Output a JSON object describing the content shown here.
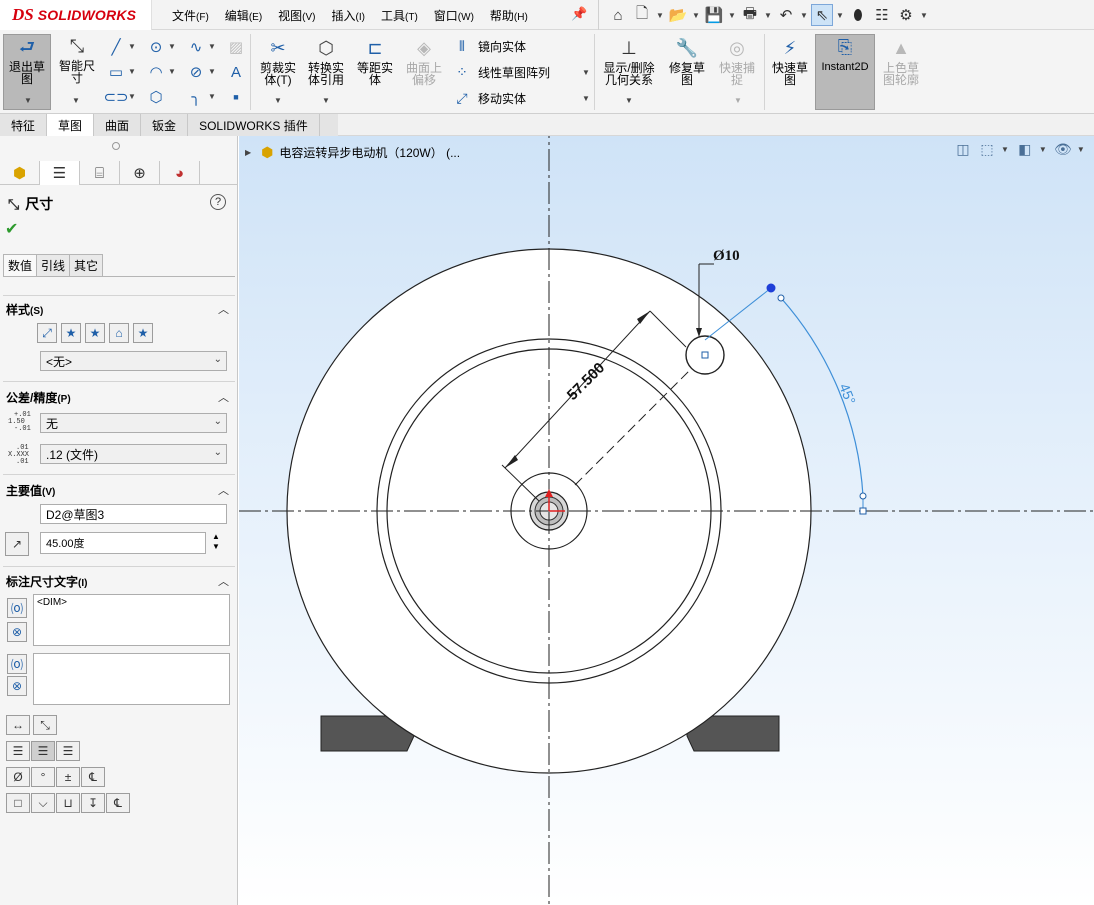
{
  "app": {
    "logo_ds": "DS",
    "logo_name": "SOLIDWORKS"
  },
  "menu": [
    {
      "label": "文件",
      "acc": "(F)"
    },
    {
      "label": "编辑",
      "acc": "(E)"
    },
    {
      "label": "视图",
      "acc": "(V)"
    },
    {
      "label": "插入",
      "acc": "(I)"
    },
    {
      "label": "工具",
      "acc": "(T)"
    },
    {
      "label": "窗口",
      "acc": "(W)"
    },
    {
      "label": "帮助",
      "acc": "(H)"
    }
  ],
  "quick_access": [
    "home-icon",
    "new-file-icon",
    "open-icon",
    "save-icon",
    "print-icon",
    "undo-icon",
    "select-icon",
    "rebuild-icon",
    "file-properties-icon",
    "options-icon"
  ],
  "ribbon": {
    "exit_sketch": "退出草图",
    "smart_dim": "智能尺寸",
    "trim": "剪裁实体(T)",
    "convert": "转换实体引用",
    "offset": "等距实体",
    "surface_offset": "曲面上偏移",
    "mirror": "镜向实体",
    "linear_pattern": "线性草图阵列",
    "move": "移动实体",
    "display_relations": "显示/删除几何关系",
    "repair": "修复草图",
    "quick_snaps": "快速捕捉",
    "rapid_sketch": "快速草图",
    "instant2d": "Instant2D",
    "shaded_contours": "上色草图轮廓"
  },
  "command_tabs": [
    "特征",
    "草图",
    "曲面",
    "钣金",
    "SOLIDWORKS 插件"
  ],
  "property_manager": {
    "title": "尺寸",
    "help": "?",
    "tabs": [
      "数值",
      "引线",
      "其它"
    ],
    "style": {
      "label": "样式",
      "acc": "(S)",
      "dropdown": "<无>"
    },
    "tolerance": {
      "label": "公差/精度",
      "acc": "(P)",
      "tol_value": "无",
      "precision_value": ".12 (文件)",
      "tol_tiny": [
        "+.01",
        "1.50",
        "-.01"
      ],
      "prec_tiny": [
        ".01",
        "X.XXX",
        ".01"
      ]
    },
    "primary": {
      "label": "主要值",
      "acc": "(V)",
      "name": "D2@草图3",
      "value": "45.00度"
    },
    "dim_text": {
      "label": "标注尺寸文字",
      "acc": "(I)",
      "text1": "<DIM>",
      "text2": ""
    }
  },
  "tree": {
    "label": "电容运转异步电动机（120W）  (..."
  },
  "drawing": {
    "dim_diameter": "10",
    "dim_length": "57.500",
    "dim_angle": "45°"
  },
  "colors": {
    "accent": "#1f5fa8",
    "selected_dim": "#3e8fd8",
    "origin_red": "#e02020",
    "feet": "#555555"
  }
}
